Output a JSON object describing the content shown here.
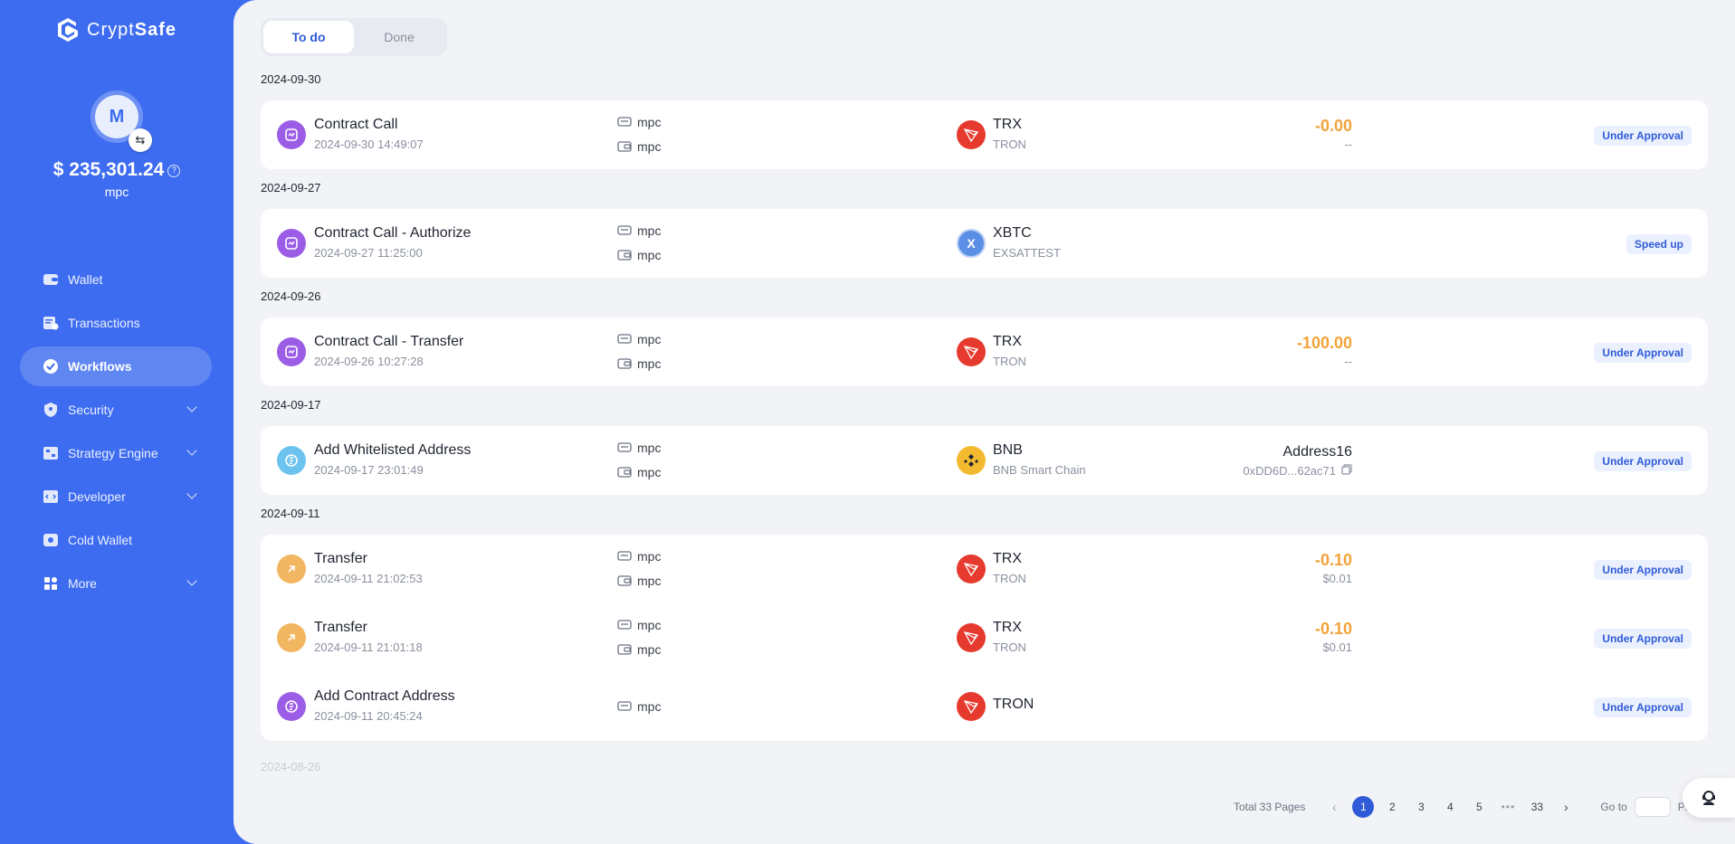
{
  "app": {
    "logo_light": "Crypt",
    "logo_bold": "Safe",
    "avatar_initial": "M",
    "balance": "$ 235,301.24",
    "balance_help": "?",
    "account_name": "mpc"
  },
  "sidebar": {
    "items": [
      {
        "label": "Wallet",
        "icon": "wallet-icon"
      },
      {
        "label": "Transactions",
        "icon": "transactions-icon"
      },
      {
        "label": "Workflows",
        "icon": "check-circle-icon",
        "active": true
      },
      {
        "label": "Security",
        "icon": "shield-icon",
        "has_children": true
      },
      {
        "label": "Strategy Engine",
        "icon": "strategy-icon",
        "has_children": true
      },
      {
        "label": "Developer",
        "icon": "developer-icon",
        "has_children": true
      },
      {
        "label": "Cold Wallet",
        "icon": "cold-wallet-icon"
      },
      {
        "label": "More",
        "icon": "grid-icon",
        "has_children": true
      }
    ]
  },
  "tabs": [
    {
      "label": "To do",
      "active": true
    },
    {
      "label": "Done",
      "active": false
    }
  ],
  "groups": [
    {
      "date": "2024-09-30",
      "rows": [
        {
          "title": "Contract Call",
          "time": "2024-09-30 14:49:07",
          "initiator": "mpc",
          "wallet": "mpc",
          "coin": "TRX",
          "network": "TRON",
          "coin_style": "tron",
          "amount": "-0.00",
          "amount_sub": "--",
          "status": "Under Approval",
          "icon": "contract-call-icon",
          "icon_color": "purple"
        }
      ]
    },
    {
      "date": "2024-09-27",
      "rows": [
        {
          "title": "Contract Call - Authorize",
          "time": "2024-09-27 11:25:00",
          "initiator": "mpc",
          "wallet": "mpc",
          "coin": "XBTC",
          "network": "EXSATTEST",
          "coin_style": "xbtc",
          "coin_letter": "X",
          "amount": "",
          "amount_sub": "",
          "status": "Speed up",
          "icon": "contract-call-icon",
          "icon_color": "purple"
        }
      ]
    },
    {
      "date": "2024-09-26",
      "rows": [
        {
          "title": "Contract Call - Transfer",
          "time": "2024-09-26 10:27:28",
          "initiator": "mpc",
          "wallet": "mpc",
          "coin": "TRX",
          "network": "TRON",
          "coin_style": "tron",
          "amount": "-100.00",
          "amount_sub": "--",
          "status": "Under Approval",
          "icon": "contract-call-icon",
          "icon_color": "purple"
        }
      ]
    },
    {
      "date": "2024-09-17",
      "rows": [
        {
          "title": "Add Whitelisted Address",
          "time": "2024-09-17 23:01:49",
          "initiator": "mpc",
          "wallet": "mpc",
          "coin": "BNB",
          "network": "BNB Smart Chain",
          "coin_style": "bnb",
          "address_name": "Address16",
          "address_value": "0xDD6D...62ac71",
          "status": "Under Approval",
          "icon": "whitelist-icon",
          "icon_color": "teal"
        }
      ]
    },
    {
      "date": "2024-09-11",
      "rows": [
        {
          "title": "Transfer",
          "time": "2024-09-11 21:02:53",
          "initiator": "mpc",
          "wallet": "mpc",
          "coin": "TRX",
          "network": "TRON",
          "coin_style": "tron",
          "amount": "-0.10",
          "amount_sub": "$0.01",
          "status": "Under Approval",
          "icon": "arrow-up-right-icon",
          "icon_color": "orange"
        },
        {
          "title": "Transfer",
          "time": "2024-09-11 21:01:18",
          "initiator": "mpc",
          "wallet": "mpc",
          "coin": "TRX",
          "network": "TRON",
          "coin_style": "tron",
          "amount": "-0.10",
          "amount_sub": "$0.01",
          "status": "Under Approval",
          "icon": "arrow-up-right-icon",
          "icon_color": "orange"
        },
        {
          "title": "Add Contract Address",
          "time": "2024-09-11 20:45:24",
          "initiator": "mpc",
          "coin": "TRON",
          "coin_style": "tron",
          "status": "Under Approval",
          "icon": "contract-address-icon",
          "icon_color": "purple"
        }
      ]
    }
  ],
  "faded_date": "2024-08-26",
  "pagination": {
    "total_label": "Total 33 Pages",
    "pages": [
      "1",
      "2",
      "3",
      "4",
      "5",
      "•••",
      "33"
    ],
    "current": "1",
    "goto_label": "Go to",
    "page_suffix": "Page"
  },
  "colors": {
    "accent": "#3d6cf0",
    "amount": "#f2a33a",
    "tron": "#e63a2e",
    "bnb": "#f3ba2f"
  }
}
